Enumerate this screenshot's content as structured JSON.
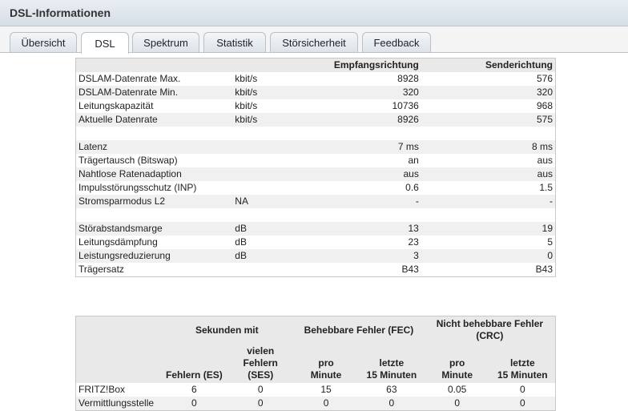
{
  "window": {
    "title": "DSL-Informationen"
  },
  "tabs": [
    "Übersicht",
    "DSL",
    "Spektrum",
    "Statistik",
    "Störsicherheit",
    "Feedback"
  ],
  "active_tab": "DSL",
  "dsl_table": {
    "headers": {
      "name": "",
      "unit": "",
      "rx": "Empfangsrichtung",
      "tx": "Senderichtung"
    },
    "rows": [
      {
        "name": "DSLAM-Datenrate Max.",
        "unit": "kbit/s",
        "rx": "8928",
        "tx": "576"
      },
      {
        "name": "DSLAM-Datenrate Min.",
        "unit": "kbit/s",
        "rx": "320",
        "tx": "320"
      },
      {
        "name": "Leitungskapazität",
        "unit": "kbit/s",
        "rx": "10736",
        "tx": "968"
      },
      {
        "name": "Aktuelle Datenrate",
        "unit": "kbit/s",
        "rx": "8926",
        "tx": "575"
      },
      {
        "name": "",
        "unit": "",
        "rx": "",
        "tx": ""
      },
      {
        "name": "Latenz",
        "unit": "",
        "rx": "7 ms",
        "tx": "8 ms"
      },
      {
        "name": "Trägertausch (Bitswap)",
        "unit": "",
        "rx": "an",
        "tx": "aus"
      },
      {
        "name": "Nahtlose Ratenadaption",
        "unit": "",
        "rx": "aus",
        "tx": "aus"
      },
      {
        "name": "Impulsstörungsschutz (INP)",
        "unit": "",
        "rx": "0.6",
        "tx": "1.5"
      },
      {
        "name": "Stromsparmodus L2",
        "unit": "NA",
        "rx": "-",
        "tx": "-"
      },
      {
        "name": "",
        "unit": "",
        "rx": "",
        "tx": ""
      },
      {
        "name": "Störabstandsmarge",
        "unit": "dB",
        "rx": "13",
        "tx": "19"
      },
      {
        "name": "Leitungsdämpfung",
        "unit": "dB",
        "rx": "23",
        "tx": "5"
      },
      {
        "name": "Leistungsreduzierung",
        "unit": "dB",
        "rx": "3",
        "tx": "0"
      },
      {
        "name": "Trägersatz",
        "unit": "",
        "rx": "B43",
        "tx": "B43"
      }
    ]
  },
  "error_table": {
    "groups": [
      "Sekunden mit",
      "Behebbare Fehler (FEC)",
      "Nicht behebbare Fehler (CRC)"
    ],
    "subheaders": [
      [
        "Fehlern (ES)"
      ],
      [
        "vielen",
        "Fehlern (SES)"
      ],
      [
        "pro",
        "Minute"
      ],
      [
        "letzte",
        "15 Minuten"
      ],
      [
        "pro",
        "Minute"
      ],
      [
        "letzte",
        "15 Minuten"
      ]
    ],
    "rows": [
      {
        "label": "FRITZ!Box",
        "values": [
          "6",
          "0",
          "15",
          "63",
          "0.05",
          "0"
        ]
      },
      {
        "label": "Vermittlungsstelle",
        "values": [
          "0",
          "0",
          "0",
          "0",
          "0",
          "0"
        ]
      }
    ]
  }
}
